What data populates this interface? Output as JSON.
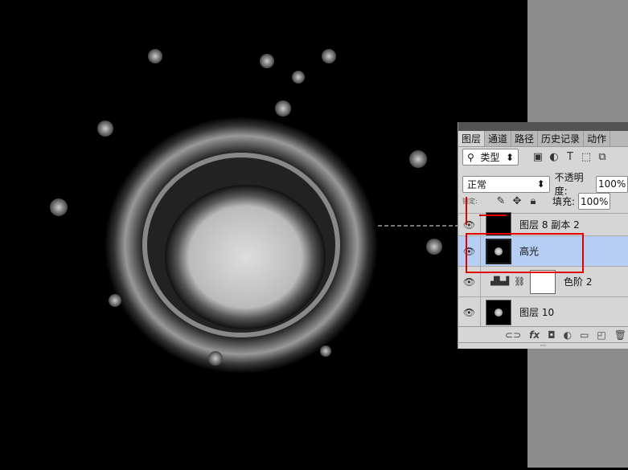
{
  "tabs": [
    {
      "label": "图层"
    },
    {
      "label": "通道"
    },
    {
      "label": "路径"
    },
    {
      "label": "历史记录"
    },
    {
      "label": "动作"
    }
  ],
  "filter": {
    "kind": "类型",
    "icons": [
      "image-filter-icon",
      "adjustment-filter-icon",
      "type-filter-icon",
      "shape-filter-icon",
      "smart-object-filter-icon"
    ]
  },
  "blend": {
    "mode": "正常",
    "opacity_label": "不透明度:",
    "opacity": "100%"
  },
  "lock": {
    "label": "锁定:",
    "fill_label": "填充:",
    "fill": "100%"
  },
  "layers": [
    {
      "name": "图层 8 副本 2",
      "visible": true
    },
    {
      "name": "高光",
      "visible": true,
      "selected": true
    },
    {
      "name": "色阶 2",
      "visible": true,
      "type": "levels-adjustment"
    },
    {
      "name": "图层 10",
      "visible": true
    }
  ],
  "colors": {
    "selected": "#b7cef4",
    "highlight": "#e00000",
    "canvas": "#000000",
    "workspace": "#8c8c8c"
  }
}
